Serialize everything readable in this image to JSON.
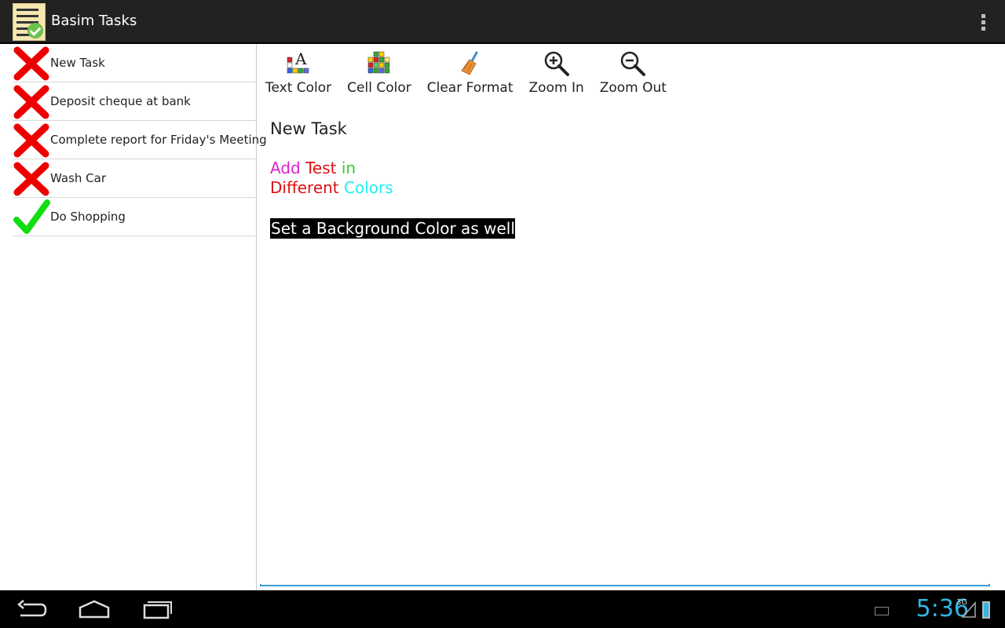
{
  "app": {
    "title": "Basim Tasks"
  },
  "tasks": [
    {
      "label": "New Task",
      "status": "incomplete"
    },
    {
      "label": "Deposit cheque at bank",
      "status": "incomplete"
    },
    {
      "label": "Complete report for Friday's Meeting",
      "status": "incomplete"
    },
    {
      "label": "Wash Car",
      "status": "incomplete"
    },
    {
      "label": "Do Shopping",
      "status": "complete"
    }
  ],
  "toolbar": {
    "text_color": "Text Color",
    "cell_color": "Cell Color",
    "clear_format": "Clear Format",
    "zoom_in": "Zoom In",
    "zoom_out": "Zoom Out"
  },
  "editor": {
    "title": "New Task",
    "line1": {
      "w1": "Add",
      "w2": "Test",
      "w3": "in"
    },
    "line2": {
      "w1": "Different",
      "w2": "Colors"
    },
    "highlight": "Set a Background Color as well"
  },
  "colors": {
    "magenta": "#dd22cc",
    "red": "#dd1111",
    "green": "#33cc33",
    "cyan": "#22eeee",
    "accent": "#33b5e5"
  },
  "statusbar": {
    "time": "5:36",
    "network": "3G"
  }
}
